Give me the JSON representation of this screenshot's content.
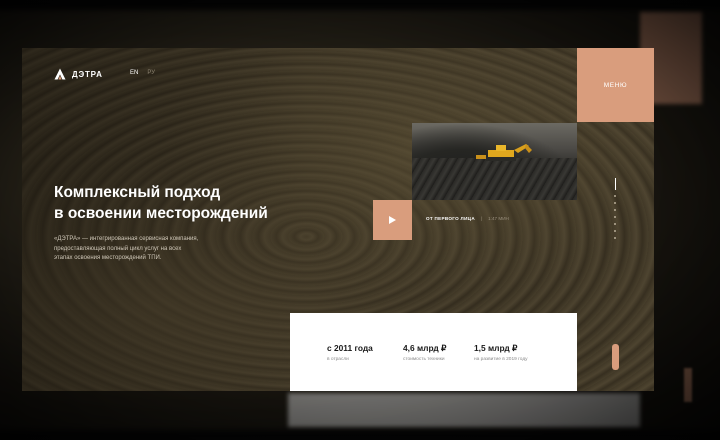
{
  "header": {
    "logo_text": "ДЭТРА",
    "lang_active": "EN",
    "lang_inactive": "РУ",
    "menu_label": "МЕНЮ"
  },
  "hero": {
    "title_line1": "Комплексный подход",
    "title_line2": "в освоении месторождений",
    "lead_line1": "«ДЭТРА» — интегрированная сервисная компания,",
    "lead_line2": "предоставляющая полный цикл услуг на всех",
    "lead_line3": "этапах освоения месторождений ТПИ."
  },
  "video": {
    "caption": "ОТ ПЕРВОГО ЛИЦА",
    "separator": "|",
    "duration": "1:47 МИН",
    "play_icon": "play-icon"
  },
  "stats": [
    {
      "value": "с 2011 года",
      "label": "в отрасли"
    },
    {
      "value": "4,6 млрд ₽",
      "label": "стоимость техники"
    },
    {
      "value": "1,5 млрд ₽",
      "label": "на развитие в 2019 году"
    }
  ],
  "slides": {
    "count": 8,
    "current": 1
  },
  "colors": {
    "accent": "#d99d7d",
    "text_light": "#ffffff",
    "stats_bg": "#ffffff"
  }
}
